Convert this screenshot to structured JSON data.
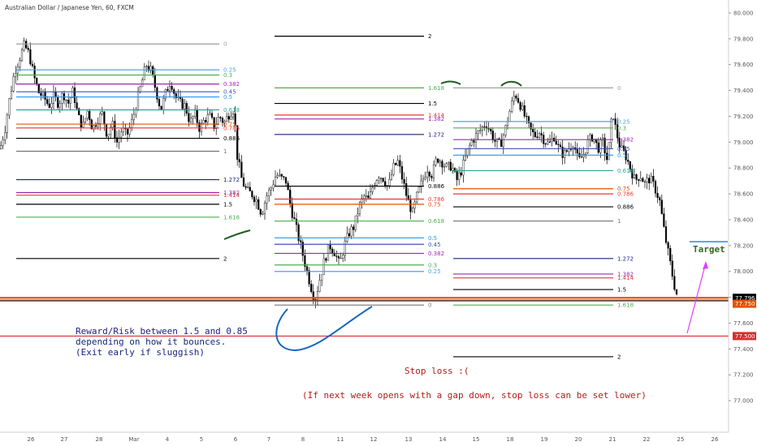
{
  "chart_data": {
    "type": "candlestick",
    "title": "Australian Dollar / Japanese Yen, 60, FXCM",
    "ylim": [
      76.8,
      80.05
    ],
    "y_ticks": [
      "80.000",
      "79.800",
      "79.600",
      "79.400",
      "79.200",
      "79.000",
      "78.800",
      "78.600",
      "78.400",
      "78.200",
      "78.000",
      "77.800",
      "77.600",
      "77.400",
      "77.200",
      "77.000"
    ],
    "x_ticks": [
      "26",
      "27",
      "28",
      "Mar",
      "4",
      "5",
      "6",
      "7",
      "8",
      "11",
      "12",
      "13",
      "14",
      "15",
      "18",
      "19",
      "20",
      "21",
      "22",
      "25",
      "26"
    ],
    "price_tags": [
      {
        "value": 77.796,
        "text": "77.796",
        "bg": "#000000",
        "fg": "#ffffff"
      },
      {
        "value": 77.75,
        "text": "77.750",
        "bg": "#e65100",
        "fg": "#ffffff"
      },
      {
        "value": 77.5,
        "text": "77.500",
        "bg": "#d32f2f",
        "fg": "#ffffff"
      }
    ],
    "fib_sets": [
      {
        "x_start": 20,
        "x_end": 270,
        "levels": [
          {
            "label": "0",
            "y": 79.76,
            "color": "#9e9e9e"
          },
          {
            "label": "0.25",
            "y": 79.56,
            "color": "#4fa3e0"
          },
          {
            "label": "0.3",
            "y": 79.52,
            "color": "#4caf50"
          },
          {
            "label": "0.382",
            "y": 79.45,
            "color": "#9c27b0"
          },
          {
            "label": "0.45",
            "y": 79.39,
            "color": "#3f51b5"
          },
          {
            "label": "0.5",
            "y": 79.35,
            "color": "#2196f3"
          },
          {
            "label": "0.618",
            "y": 79.25,
            "color": "#26a69a"
          },
          {
            "label": "0.75",
            "y": 79.14,
            "color": "#e65100"
          },
          {
            "label": "0.786",
            "y": 79.11,
            "color": "#e53935"
          },
          {
            "label": "0.886",
            "y": 79.03,
            "color": "#000000"
          },
          {
            "label": "1",
            "y": 78.93,
            "color": "#757575"
          },
          {
            "label": "1.272",
            "y": 78.71,
            "color": "#1a237e"
          },
          {
            "label": "1.382",
            "y": 78.61,
            "color": "#9c27b0"
          },
          {
            "label": "1.414",
            "y": 78.59,
            "color": "#e53935"
          },
          {
            "label": "1.5",
            "y": 78.52,
            "color": "#000000"
          },
          {
            "label": "1.618",
            "y": 78.42,
            "color": "#4caf50"
          },
          {
            "label": "2",
            "y": 78.1,
            "color": "#000000"
          }
        ]
      },
      {
        "x_start": 338,
        "x_end": 522,
        "levels": [
          {
            "label": "2",
            "y": 79.82,
            "color": "#000000"
          },
          {
            "label": "1.618",
            "y": 79.42,
            "color": "#4caf50"
          },
          {
            "label": "1.5",
            "y": 79.3,
            "color": "#000000"
          },
          {
            "label": "1.414",
            "y": 79.21,
            "color": "#e53935"
          },
          {
            "label": "1.382",
            "y": 79.18,
            "color": "#9c27b0"
          },
          {
            "label": "1.272",
            "y": 79.06,
            "color": "#1a237e"
          },
          {
            "label": "0.886",
            "y": 78.66,
            "color": "#000000"
          },
          {
            "label": "0.786",
            "y": 78.56,
            "color": "#e53935"
          },
          {
            "label": "0.75",
            "y": 78.52,
            "color": "#e65100"
          },
          {
            "label": "0.618",
            "y": 78.39,
            "color": "#4caf50"
          },
          {
            "label": "0.5",
            "y": 78.26,
            "color": "#2196f3"
          },
          {
            "label": "0.45",
            "y": 78.21,
            "color": "#3f51b5"
          },
          {
            "label": "0.382",
            "y": 78.14,
            "color": "#9c27b0"
          },
          {
            "label": "0.3",
            "y": 78.05,
            "color": "#4caf50"
          },
          {
            "label": "0.25",
            "y": 78.0,
            "color": "#4fa3e0"
          },
          {
            "label": "0",
            "y": 77.74,
            "color": "#757575"
          }
        ]
      },
      {
        "x_start": 558,
        "x_end": 755,
        "levels": [
          {
            "label": "0",
            "y": 79.42,
            "color": "#9e9e9e"
          },
          {
            "label": "0.25",
            "y": 79.16,
            "color": "#4fa3e0"
          },
          {
            "label": "0.3",
            "y": 79.11,
            "color": "#4caf50"
          },
          {
            "label": "0.382",
            "y": 79.02,
            "color": "#9c27b0"
          },
          {
            "label": "0.45",
            "y": 78.95,
            "color": "#3f51b5"
          },
          {
            "label": "0.5",
            "y": 78.9,
            "color": "#2196f3"
          },
          {
            "label": "0.618",
            "y": 78.78,
            "color": "#26a69a"
          },
          {
            "label": "0.75",
            "y": 78.64,
            "color": "#e65100"
          },
          {
            "label": "0.786",
            "y": 78.6,
            "color": "#e53935"
          },
          {
            "label": "0.886",
            "y": 78.5,
            "color": "#000000"
          },
          {
            "label": "1",
            "y": 78.39,
            "color": "#757575"
          },
          {
            "label": "1.272",
            "y": 78.1,
            "color": "#1a237e"
          },
          {
            "label": "1.382",
            "y": 77.98,
            "color": "#9c27b0"
          },
          {
            "label": "1.414",
            "y": 77.95,
            "color": "#e53935"
          },
          {
            "label": "1.5",
            "y": 77.86,
            "color": "#000000"
          },
          {
            "label": "1.618",
            "y": 77.74,
            "color": "#4caf50"
          },
          {
            "label": "2",
            "y": 77.34,
            "color": "#000000"
          }
        ]
      }
    ],
    "horizontal_lines": [
      {
        "y": 77.796,
        "color": "#e65100"
      },
      {
        "y": 77.775,
        "color": "#6d4c41"
      },
      {
        "y": 77.5,
        "color": "#d32f2f"
      }
    ],
    "target_line": {
      "y": 78.23,
      "color": "#4fa3e0"
    },
    "price_path": [
      [
        0,
        78.95
      ],
      [
        6,
        79.1
      ],
      [
        12,
        79.35
      ],
      [
        18,
        79.55
      ],
      [
        24,
        79.65
      ],
      [
        30,
        79.75
      ],
      [
        36,
        79.68
      ],
      [
        42,
        79.5
      ],
      [
        48,
        79.38
      ],
      [
        54,
        79.35
      ],
      [
        60,
        79.28
      ],
      [
        66,
        79.35
      ],
      [
        72,
        79.3
      ],
      [
        78,
        79.38
      ],
      [
        84,
        79.3
      ],
      [
        90,
        79.4
      ],
      [
        96,
        79.2
      ],
      [
        102,
        79.12
      ],
      [
        108,
        79.25
      ],
      [
        114,
        79.1
      ],
      [
        120,
        79.18
      ],
      [
        126,
        79.22
      ],
      [
        132,
        79.05
      ],
      [
        138,
        79.15
      ],
      [
        144,
        79.0
      ],
      [
        150,
        79.1
      ],
      [
        156,
        79.05
      ],
      [
        162,
        79.15
      ],
      [
        168,
        79.3
      ],
      [
        174,
        79.45
      ],
      [
        180,
        79.6
      ],
      [
        186,
        79.55
      ],
      [
        192,
        79.4
      ],
      [
        198,
        79.25
      ],
      [
        204,
        79.38
      ],
      [
        210,
        79.48
      ],
      [
        216,
        79.35
      ],
      [
        222,
        79.3
      ],
      [
        228,
        79.28
      ],
      [
        234,
        79.15
      ],
      [
        240,
        79.22
      ],
      [
        246,
        79.1
      ],
      [
        252,
        79.18
      ],
      [
        258,
        79.2
      ],
      [
        264,
        79.12
      ],
      [
        270,
        79.2
      ],
      [
        276,
        79.15
      ],
      [
        282,
        79.22
      ],
      [
        288,
        79.26
      ],
      [
        292,
        78.9
      ],
      [
        298,
        78.7
      ],
      [
        304,
        78.62
      ],
      [
        310,
        78.6
      ],
      [
        316,
        78.55
      ],
      [
        322,
        78.45
      ],
      [
        328,
        78.58
      ],
      [
        334,
        78.65
      ],
      [
        340,
        78.75
      ],
      [
        346,
        78.72
      ],
      [
        352,
        78.7
      ],
      [
        358,
        78.5
      ],
      [
        364,
        78.35
      ],
      [
        370,
        78.2
      ],
      [
        376,
        78.05
      ],
      [
        382,
        77.9
      ],
      [
        388,
        77.78
      ],
      [
        394,
        77.95
      ],
      [
        400,
        78.1
      ],
      [
        406,
        78.2
      ],
      [
        412,
        78.15
      ],
      [
        418,
        78.05
      ],
      [
        424,
        78.2
      ],
      [
        430,
        78.3
      ],
      [
        436,
        78.35
      ],
      [
        442,
        78.5
      ],
      [
        448,
        78.58
      ],
      [
        454,
        78.55
      ],
      [
        460,
        78.68
      ],
      [
        466,
        78.75
      ],
      [
        472,
        78.72
      ],
      [
        478,
        78.65
      ],
      [
        484,
        78.8
      ],
      [
        490,
        78.85
      ],
      [
        496,
        78.7
      ],
      [
        502,
        78.55
      ],
      [
        508,
        78.45
      ],
      [
        514,
        78.6
      ],
      [
        520,
        78.7
      ],
      [
        526,
        78.8
      ],
      [
        532,
        78.75
      ],
      [
        538,
        78.88
      ],
      [
        544,
        78.85
      ],
      [
        550,
        78.8
      ],
      [
        556,
        78.82
      ],
      [
        562,
        78.7
      ],
      [
        568,
        78.78
      ],
      [
        574,
        78.9
      ],
      [
        580,
        79.0
      ],
      [
        586,
        79.05
      ],
      [
        592,
        79.1
      ],
      [
        598,
        79.15
      ],
      [
        604,
        79.08
      ],
      [
        610,
        79.0
      ],
      [
        616,
        78.98
      ],
      [
        622,
        79.1
      ],
      [
        628,
        79.25
      ],
      [
        634,
        79.38
      ],
      [
        640,
        79.3
      ],
      [
        646,
        79.2
      ],
      [
        652,
        79.1
      ],
      [
        658,
        79.05
      ],
      [
        664,
        79.08
      ],
      [
        670,
        79.02
      ],
      [
        676,
        78.98
      ],
      [
        682,
        79.05
      ],
      [
        688,
        78.95
      ],
      [
        694,
        78.9
      ],
      [
        700,
        78.95
      ],
      [
        706,
        79.0
      ],
      [
        712,
        78.85
      ],
      [
        718,
        78.9
      ],
      [
        724,
        79.0
      ],
      [
        730,
        79.05
      ],
      [
        736,
        78.95
      ],
      [
        742,
        79.0
      ],
      [
        748,
        78.85
      ],
      [
        754,
        79.25
      ],
      [
        758,
        79.1
      ],
      [
        764,
        78.95
      ],
      [
        770,
        78.9
      ],
      [
        776,
        78.8
      ],
      [
        782,
        78.7
      ],
      [
        788,
        78.75
      ],
      [
        794,
        78.68
      ],
      [
        800,
        78.72
      ],
      [
        806,
        78.65
      ],
      [
        812,
        78.55
      ],
      [
        818,
        78.3
      ],
      [
        824,
        78.1
      ],
      [
        830,
        77.9
      ],
      [
        834,
        77.8
      ]
    ],
    "annotations": {
      "target": "Target",
      "rr_lines": [
        "Reward/Risk between 1.5 and 0.85",
        "depending on how it bounces.",
        "(Exit early if sluggish)"
      ],
      "stop_loss": "Stop loss :(",
      "gap_note": "(If next week opens with a gap down, stop loss can be set lower)"
    },
    "colors": {
      "candle_up": "#000000",
      "candle_down": "#000000",
      "annotation_blue": "#1a237e",
      "annotation_red": "#b71c1c",
      "target_text": "#33691e",
      "pink_arrow": "#e040fb",
      "ink_blue": "#1565c0",
      "ink_green": "#1b5e20"
    }
  }
}
